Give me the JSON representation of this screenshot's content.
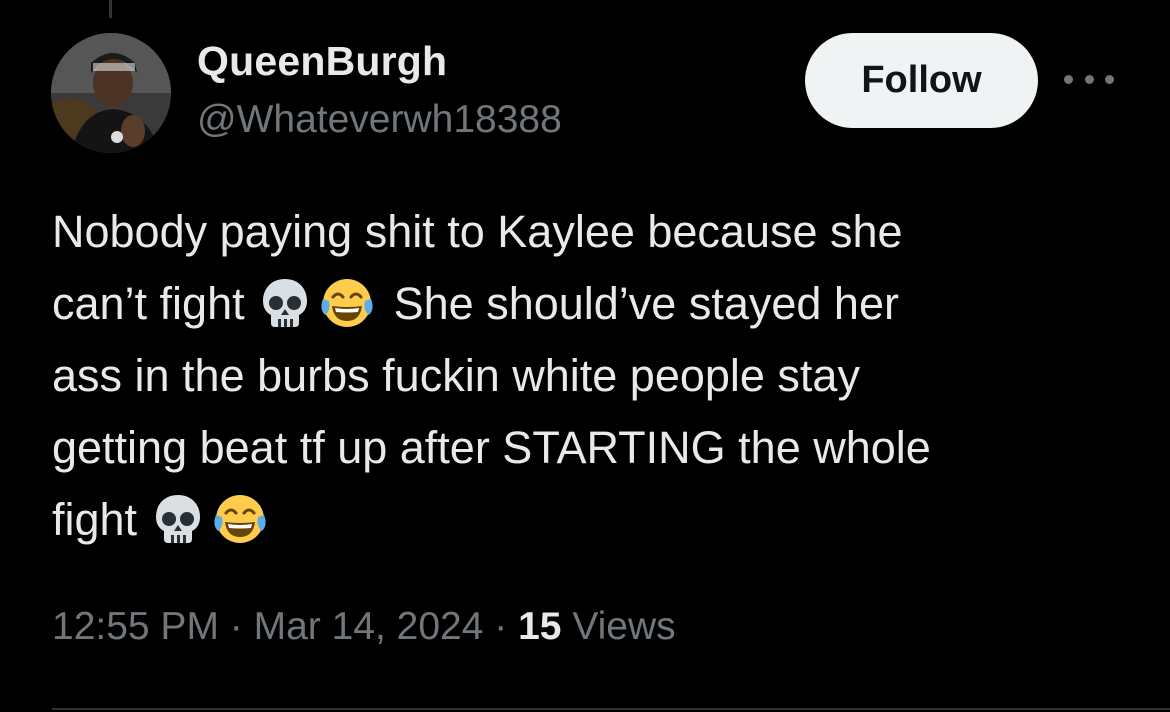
{
  "author": {
    "display_name": "QueenBurgh",
    "handle": "@Whateverwh18388",
    "avatar_icon": "profile-photo-avatar"
  },
  "actions": {
    "follow_label": "Follow",
    "more_icon": "more-horizontal-icon"
  },
  "tweet": {
    "segments": [
      {
        "type": "text",
        "value": "Nobody paying shit to Kaylee because she\ncan’t fight "
      },
      {
        "type": "emoji",
        "name": "skull-emoji"
      },
      {
        "type": "emoji",
        "name": "face-with-tears-of-joy-emoji"
      },
      {
        "type": "text",
        "value": " She should’ve stayed her\nass in the burbs fuckin white people stay\ngetting beat tf up after STARTING the whole\nfight "
      },
      {
        "type": "emoji",
        "name": "skull-emoji"
      },
      {
        "type": "emoji",
        "name": "face-with-tears-of-joy-emoji"
      }
    ]
  },
  "meta": {
    "time": "12:55 PM",
    "separator": " · ",
    "date": "Mar 14, 2024",
    "views_count": "15",
    "views_label": " Views"
  },
  "colors": {
    "background": "#000000",
    "primary_text": "#e7e9ea",
    "secondary_text": "#71767b",
    "follow_bg": "#eff3f4"
  }
}
